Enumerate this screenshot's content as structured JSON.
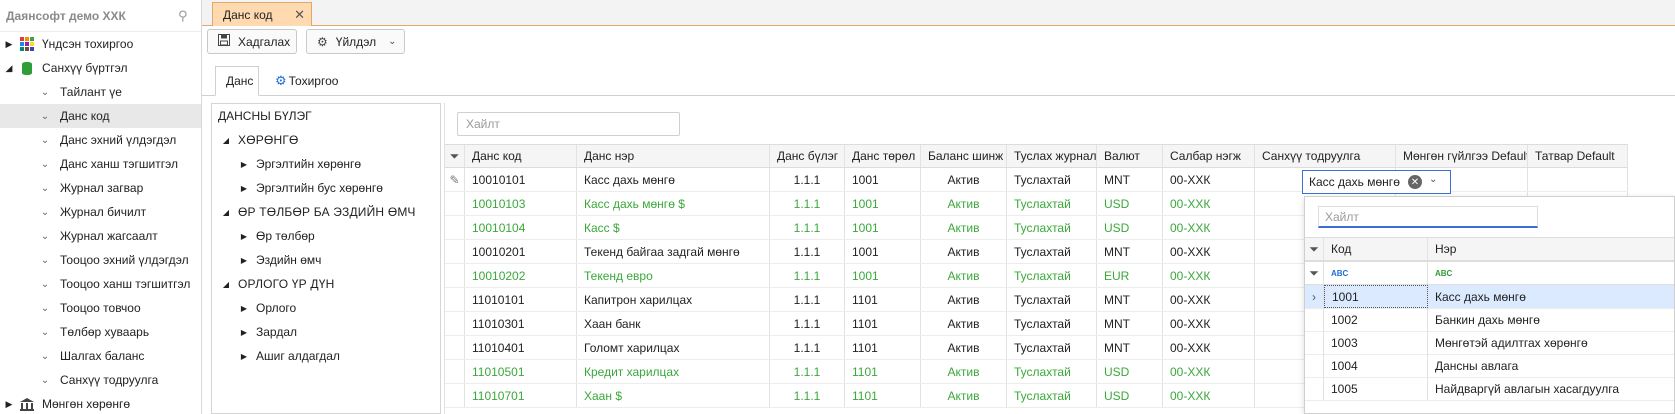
{
  "sidebar": {
    "title": "Даянсофт демо ХХК",
    "items": [
      {
        "label": "Үндсэн тохиргоо",
        "type": "parent-collapsed",
        "icon": "apps-grid-icon"
      },
      {
        "label": "Санхүү бүртгэл",
        "type": "parent-expanded",
        "icon": "database-icon"
      },
      {
        "label": "Тайлант үе",
        "type": "child"
      },
      {
        "label": "Данс код",
        "type": "child",
        "selected": true
      },
      {
        "label": "Данс эхний үлдэгдэл",
        "type": "child"
      },
      {
        "label": "Данс ханш тэгшитгэл",
        "type": "child"
      },
      {
        "label": "Журнал загвар",
        "type": "child"
      },
      {
        "label": "Журнал бичилт",
        "type": "child"
      },
      {
        "label": "Журнал жагсаалт",
        "type": "child"
      },
      {
        "label": "Тооцоо эхний үлдэгдэл",
        "type": "child"
      },
      {
        "label": "Тооцоо ханш тэгшитгэл",
        "type": "child"
      },
      {
        "label": "Тооцоо товчоо",
        "type": "child"
      },
      {
        "label": "Төлбөр хуваарь",
        "type": "child"
      },
      {
        "label": "Шалгах баланс",
        "type": "child"
      },
      {
        "label": "Санхүү тодруулга",
        "type": "child"
      },
      {
        "label": "Мөнгөн хөрөнгө",
        "type": "parent-collapsed",
        "icon": "bank-icon"
      }
    ]
  },
  "tab": {
    "label": "Данс код"
  },
  "toolbar": {
    "save_label": "Хадгалах",
    "actions_label": "Үйлдэл"
  },
  "subtabs": {
    "account": "Данс",
    "settings": "Тохиргоо"
  },
  "tree": {
    "header": "ДАНСНЫ БҮЛЭГ",
    "items": [
      {
        "label": "ХӨРӨНГӨ",
        "level": 1
      },
      {
        "label": "Эргэлтийн хөрөнгө",
        "level": 2
      },
      {
        "label": "Эргэлтийн бус хөрөнгө",
        "level": 2
      },
      {
        "label": "ӨР ТӨЛБӨР БА ЭЗДИЙН ӨМЧ",
        "level": 1
      },
      {
        "label": "Өр төлбөр",
        "level": 2
      },
      {
        "label": "Эздийн өмч",
        "level": 2
      },
      {
        "label": "ОРЛОГО ҮР ДҮН",
        "level": 1
      },
      {
        "label": "Орлого",
        "level": 2
      },
      {
        "label": "Зардал",
        "level": 2
      },
      {
        "label": "Ашиг алдагдал",
        "level": 2
      }
    ]
  },
  "grid": {
    "search_placeholder": "Хайлт",
    "columns": [
      "Данс код",
      "Данс нэр",
      "Данс бүлэг",
      "Данс төрөл",
      "Баланс шинж",
      "Туслах журнал",
      "Валют",
      "Салбар нэгж",
      "Санхүү тодруулга",
      "Мөнгөн гүйлгээ Default",
      "Татвар Default"
    ],
    "rows": [
      {
        "code": "10010101",
        "name": "Касс дахь мөнгө",
        "group": "1.1.1",
        "type": "1001",
        "balance": "Актив",
        "journal": "Туслахтай",
        "currency": "MNT",
        "branch": "00-ХХК",
        "green": false,
        "editing": true
      },
      {
        "code": "10010103",
        "name": "Касс дахь мөнгө $",
        "group": "1.1.1",
        "type": "1001",
        "balance": "Актив",
        "journal": "Туслахтай",
        "currency": "USD",
        "branch": "00-ХХК",
        "green": true
      },
      {
        "code": "10010104",
        "name": "Касс $",
        "group": "1.1.1",
        "type": "1001",
        "balance": "Актив",
        "journal": "Туслахтай",
        "currency": "USD",
        "branch": "00-ХХК",
        "green": true
      },
      {
        "code": "10010201",
        "name": "Текенд байгаа задгай мөнгө",
        "group": "1.1.1",
        "type": "1001",
        "balance": "Актив",
        "journal": "Туслахтай",
        "currency": "MNT",
        "branch": "00-ХХК",
        "green": false
      },
      {
        "code": "10010202",
        "name": "Текенд евро",
        "group": "1.1.1",
        "type": "1001",
        "balance": "Актив",
        "journal": "Туслахтай",
        "currency": "EUR",
        "branch": "00-ХХК",
        "green": true
      },
      {
        "code": "11010101",
        "name": "Капитрон харилцах",
        "group": "1.1.1",
        "type": "1101",
        "balance": "Актив",
        "journal": "Туслахтай",
        "currency": "MNT",
        "branch": "00-ХХК",
        "green": false
      },
      {
        "code": "11010301",
        "name": "Хаан банк",
        "group": "1.1.1",
        "type": "1101",
        "balance": "Актив",
        "journal": "Туслахтай",
        "currency": "MNT",
        "branch": "00-ХХК",
        "green": false
      },
      {
        "code": "11010401",
        "name": "Голомт харилцах",
        "group": "1.1.1",
        "type": "1101",
        "balance": "Актив",
        "journal": "Туслахтай",
        "currency": "MNT",
        "branch": "00-ХХК",
        "green": false
      },
      {
        "code": "11010501",
        "name": "Кредит харилцах",
        "group": "1.1.1",
        "type": "1101",
        "balance": "Актив",
        "journal": "Туслахтай",
        "currency": "USD",
        "branch": "00-ХХК",
        "green": true
      },
      {
        "code": "11010701",
        "name": "Хаан $",
        "group": "1.1.1",
        "type": "1101",
        "balance": "Актив",
        "journal": "Туслахтай",
        "currency": "USD",
        "branch": "00-ХХК",
        "green": true
      }
    ],
    "editor_value": "Касс дахь мөнгө"
  },
  "popup": {
    "search_placeholder": "Хайлт",
    "columns": [
      "Код",
      "Нэр"
    ],
    "rows": [
      {
        "code": "1001",
        "name": "Касс дахь мөнгө",
        "selected": true
      },
      {
        "code": "1002",
        "name": "Банкин дахь мөнгө"
      },
      {
        "code": "1003",
        "name": "Мөнгөтэй адилтгах хөрөнгө"
      },
      {
        "code": "1004",
        "name": "Дансны авлага"
      },
      {
        "code": "1005",
        "name": "Найдваргүй авлагын хасагдуулга"
      }
    ]
  },
  "colors": {
    "accent_tab": "#ffd9b0",
    "green_text": "#3aa83a",
    "focus_blue": "#3a6fd8"
  }
}
